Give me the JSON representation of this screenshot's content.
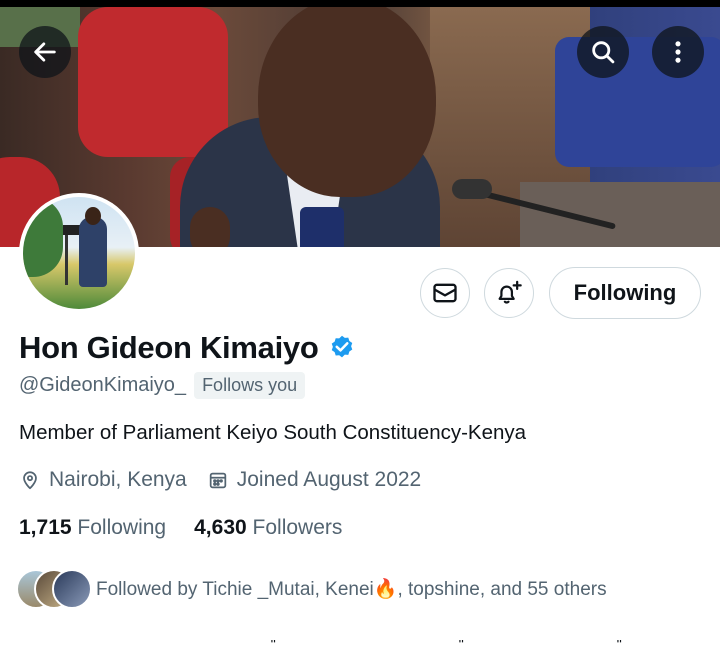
{
  "profile": {
    "name": "Hon Gideon Kimaiyo",
    "handle": "@GideonKimaiyo_",
    "follows_you": "Follows you",
    "bio": "Member of Parliament Keiyo South Constituency-Kenya",
    "location": "Nairobi, Kenya",
    "joined": "Joined August 2022",
    "verified_color": "#1d9bf0"
  },
  "stats": {
    "following_count": "1,715",
    "following_label": "Following",
    "followers_count": "4,630",
    "followers_label": "Followers"
  },
  "actions": {
    "following_button": "Following"
  },
  "followed_by": {
    "prefix": "Followed by Tichie _Mutai, Kenei",
    "emoji": "🔥",
    "suffix": ", topshine, and 55 others"
  },
  "icons": {
    "back": "arrow-left-icon",
    "search": "search-icon",
    "more": "more-vertical-icon",
    "message": "envelope-icon",
    "notify": "bell-plus-icon",
    "location": "location-pin-icon",
    "calendar": "calendar-icon",
    "verified": "verified-badge-icon"
  }
}
